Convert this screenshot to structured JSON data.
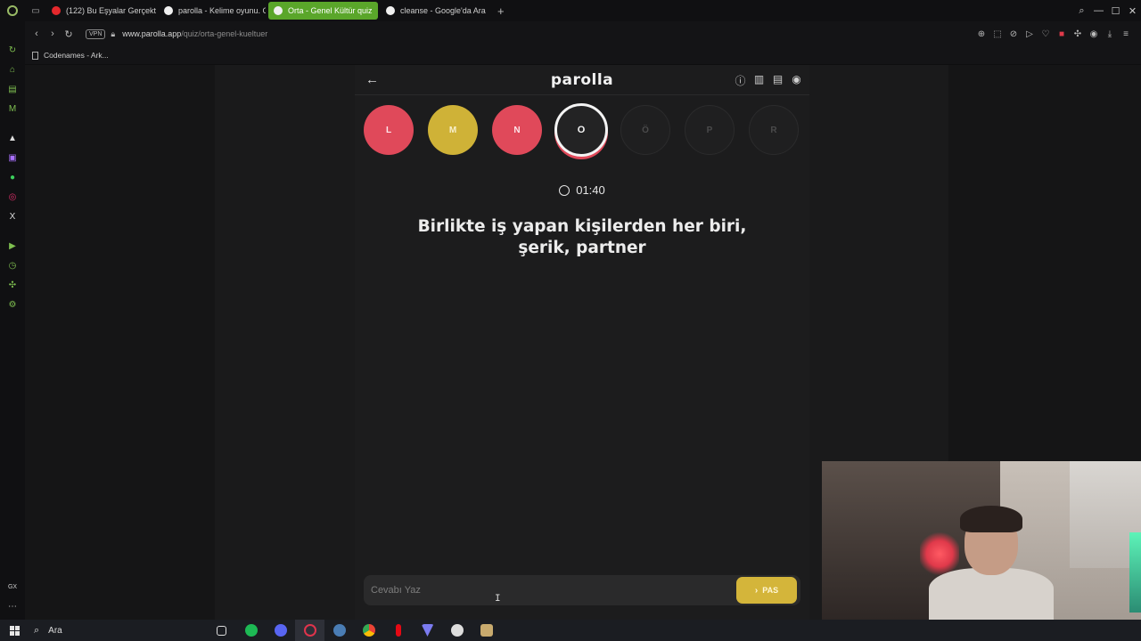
{
  "browser": {
    "tabs": [
      {
        "title": "(122) Bu Eşyalar Gerçekte",
        "color": "#e5282c",
        "active": false
      },
      {
        "title": "parolla - Kelime oyunu. G",
        "color": "#f0f0f0",
        "active": false
      },
      {
        "title": "Orta - Genel Kültür quiz",
        "color": "#f0f0f0",
        "active": true
      },
      {
        "title": "cleanse - Google'da Ara",
        "color": "#f0f0f0",
        "active": false
      }
    ],
    "new_tab": "+",
    "vpn_label": "VPN",
    "url_host": "www.parolla.app",
    "url_path": "/quiz/orta-genel-kueltuer",
    "bookmark": "Codenames - Ark..."
  },
  "app": {
    "logo": "parolla",
    "letters": [
      {
        "char": "L",
        "state": "wrong"
      },
      {
        "char": "M",
        "state": "pass"
      },
      {
        "char": "N",
        "state": "wrong"
      },
      {
        "char": "O",
        "state": "current"
      },
      {
        "char": "Ö",
        "state": "pending"
      },
      {
        "char": "P",
        "state": "pending"
      },
      {
        "char": "R",
        "state": "pending"
      }
    ],
    "timer": "01:40",
    "question": "Birlikte iş yapan kişilerden her biri, şerik, partner",
    "answer_placeholder": "Cevabı Yaz",
    "answer_value": "",
    "pass_label": "PAS"
  },
  "taskbar": {
    "search_label": "Ara"
  },
  "colors": {
    "wrong": "#e0495a",
    "pass": "#cfb237",
    "accent": "#5aa62a"
  }
}
